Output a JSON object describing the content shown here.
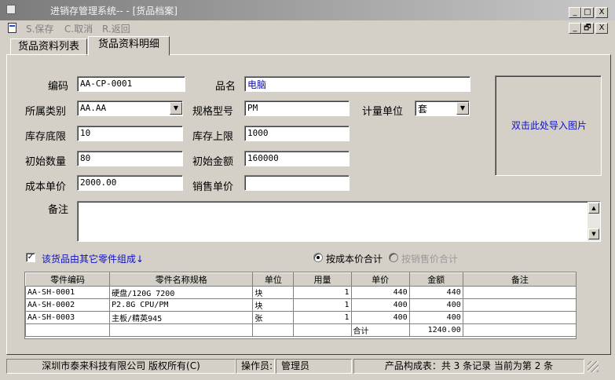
{
  "window": {
    "title": "进销存管理系统-- - [货品档案]",
    "controls": {
      "minimize": "_",
      "maximize": "□",
      "close": "X",
      "restore": "🗗"
    }
  },
  "toolbar": {
    "save_label": "S.保存",
    "cancel_label": "C.取消",
    "back_label": "R.返回"
  },
  "tabs": [
    {
      "label": "货品资料列表",
      "active": false
    },
    {
      "label": "货品资料明细",
      "active": true
    }
  ],
  "form": {
    "code": {
      "label": "编码",
      "value": "AA-CP-0001"
    },
    "name": {
      "label": "品名",
      "value": "电脑"
    },
    "category": {
      "label": "所属类别",
      "value": "AA.AA"
    },
    "spec": {
      "label": "规格型号",
      "value": "PM"
    },
    "unit": {
      "label": "计量单位",
      "value": "套"
    },
    "stock_min": {
      "label": "库存底限",
      "value": "10"
    },
    "stock_max": {
      "label": "库存上限",
      "value": "1000"
    },
    "init_qty": {
      "label": "初始数量",
      "value": "80"
    },
    "init_amount": {
      "label": "初始金额",
      "value": "160000"
    },
    "cost_price": {
      "label": "成本单价",
      "value": "2000.00"
    },
    "sale_price": {
      "label": "销售单价",
      "value": ""
    },
    "remark": {
      "label": "备注",
      "value": ""
    }
  },
  "image_box": {
    "text": "双击此处导入图片"
  },
  "components": {
    "checkbox_label": "该货品由其它零件组成↓",
    "checked": true,
    "radio_cost": "按成本价合计",
    "radio_sale": "按销售价合计",
    "selected": "cost"
  },
  "table": {
    "columns": [
      "零件编码",
      "零件名称规格",
      "单位",
      "用量",
      "单价",
      "金额",
      "备注"
    ],
    "rows": [
      [
        "AA-SH-0001",
        "硬盘/120G 7200",
        "块",
        "1",
        "440",
        "440",
        ""
      ],
      [
        "AA-SH-0002",
        "P2.8G CPU/PM",
        "块",
        "1",
        "400",
        "400",
        ""
      ],
      [
        "AA-SH-0003",
        "主板/精英945",
        "张",
        "1",
        "400",
        "400",
        ""
      ]
    ],
    "total_label": "合计",
    "total_value": "1240.00"
  },
  "status": {
    "company": "深圳市泰来科技有限公司 版权所有(C)",
    "operator_label": "操作员:",
    "operator": "管理员",
    "record_info": "产品构成表：共 3 条记录 当前为第 2 条"
  },
  "colors": {
    "link_blue": "#1010c0",
    "face": "#d4d0c8",
    "title_dark": "#7b7b7b"
  }
}
